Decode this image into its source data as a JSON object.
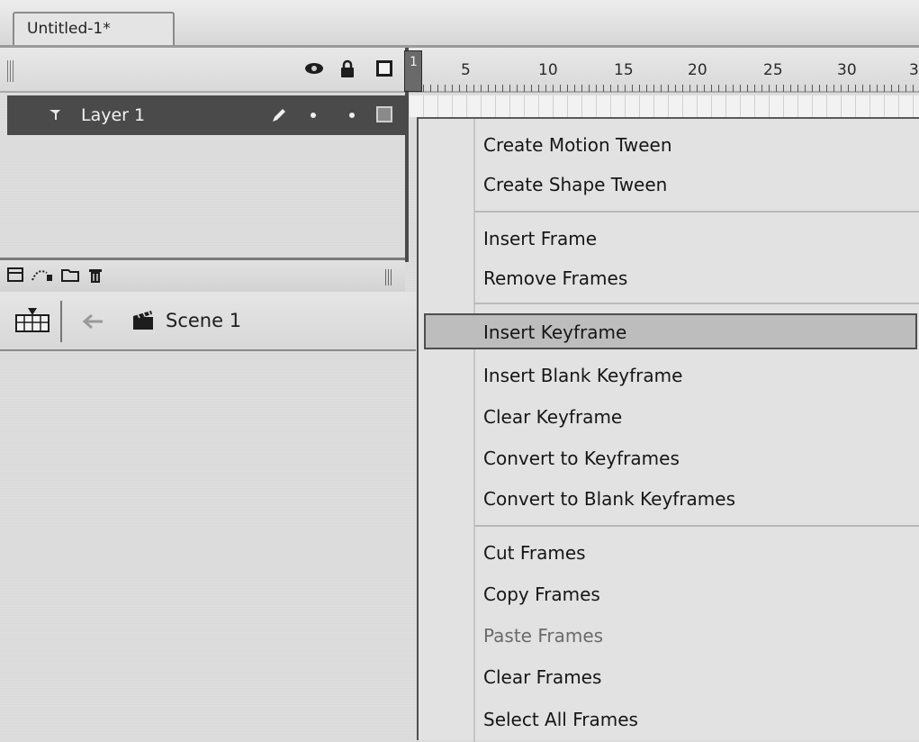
{
  "document_tab": {
    "title": "Untitled-1*"
  },
  "timeline": {
    "playhead_frame": "1",
    "ruler_numbers": [
      "5",
      "10",
      "15",
      "20",
      "25",
      "30",
      "3"
    ],
    "layers": [
      {
        "name": "Layer 1"
      }
    ]
  },
  "scene_bar": {
    "scene_name": "Scene 1"
  },
  "context_menu": {
    "items": [
      {
        "label": "Create Motion Tween"
      },
      {
        "label": "Create Shape Tween"
      },
      {
        "label": "Insert Frame"
      },
      {
        "label": "Remove Frames"
      },
      {
        "label": "Insert Keyframe",
        "highlighted": true
      },
      {
        "label": "Insert Blank Keyframe"
      },
      {
        "label": "Clear Keyframe"
      },
      {
        "label": "Convert to Keyframes"
      },
      {
        "label": "Convert to Blank Keyframes"
      },
      {
        "label": "Cut Frames"
      },
      {
        "label": "Copy Frames"
      },
      {
        "label": "Paste Frames",
        "disabled": true
      },
      {
        "label": "Clear Frames"
      },
      {
        "label": "Select All Frames"
      }
    ]
  },
  "icons": {
    "header": [
      "eye-icon",
      "lock-icon",
      "outline-icon"
    ],
    "layer_row": [
      "layer-icon",
      "pencil-icon"
    ],
    "layer_tools": [
      "new-layer-icon",
      "motion-guide-icon",
      "folder-icon",
      "trash-icon"
    ],
    "scene_bar": [
      "edit-timeline-icon",
      "back-arrow-icon",
      "scene-clapper-icon"
    ]
  },
  "colors": {
    "layer_row_bg": "#4a4a4a",
    "menu_bg": "#e2e2e2",
    "menu_highlight": "#bdbdbd"
  }
}
